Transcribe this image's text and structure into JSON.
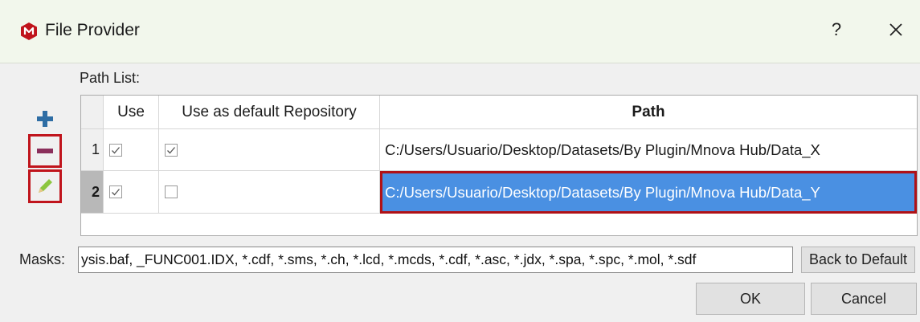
{
  "dialog": {
    "title": "File Provider",
    "help_symbol": "?",
    "close_symbol": "×",
    "app_icon": "mnova-logo-icon",
    "accent_color": "#c0141c"
  },
  "path_list": {
    "label": "Path List:",
    "side_buttons": [
      {
        "icon": "plus-icon",
        "color": "#2e6da4"
      },
      {
        "icon": "minus-icon",
        "color": "#8b2f5b"
      },
      {
        "icon": "pencil-icon",
        "color": "#8cc63f"
      }
    ],
    "columns": {
      "use": "Use",
      "default_repo": "Use as default Repository",
      "path": "Path"
    },
    "rows": [
      {
        "num": "1",
        "use": true,
        "default": true,
        "path": "C:/Users/Usuario/Desktop/Datasets/By Plugin/Mnova Hub/Data_X",
        "selected": false
      },
      {
        "num": "2",
        "use": true,
        "default": false,
        "path": "C:/Users/Usuario/Desktop/Datasets/By Plugin/Mnova Hub/Data_Y",
        "selected": true
      }
    ],
    "selection_color": "#4a90e2"
  },
  "masks": {
    "label": "Masks:",
    "value": "ysis.baf, _FUNC001.IDX, *.cdf, *.sms, *.ch, *.lcd, *.mcds, *.cdf, *.asc, *.jdx, *.spa, *.spc, *.mol, *.sdf",
    "back_to_default": "Back to Default"
  },
  "buttons": {
    "ok": "OK",
    "cancel": "Cancel"
  }
}
